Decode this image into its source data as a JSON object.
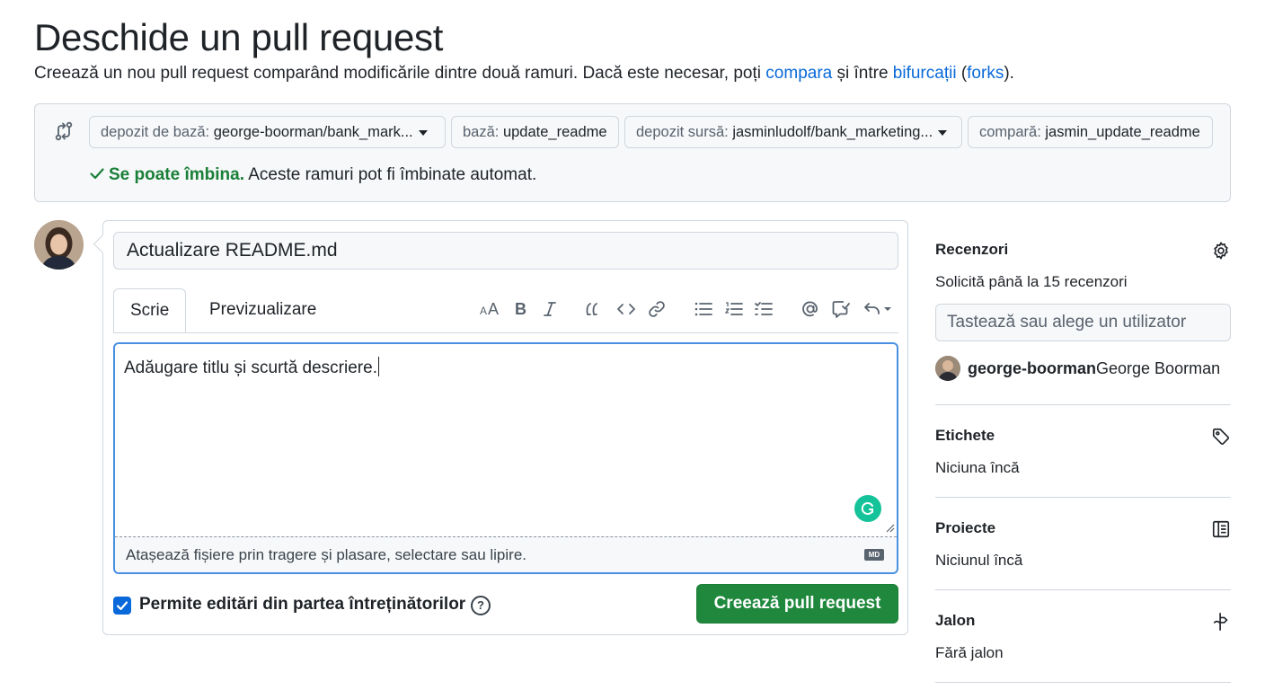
{
  "page": {
    "title": "Deschide un pull request",
    "subtitle_prefix": "Creează un nou pull request comparând modificările dintre două ramuri. Dacă este necesar, poți ",
    "link_compare": "compara",
    "subtitle_mid": " și între ",
    "link_forks_ro": "bifurcații",
    "paren_open": " (",
    "link_forks": "forks",
    "paren_close": ")."
  },
  "compare": {
    "base_repo_label": "depozit de bază: ",
    "base_repo_value": "george-boorman/bank_mark...",
    "base_label": "bază: ",
    "base_value": "update_readme",
    "head_repo_label": "depozit sursă: ",
    "head_repo_value": "jasminludolf/bank_marketing...",
    "compare_label": "compară: ",
    "compare_value": "jasmin_update_readme",
    "merge_ok": "Se poate îmbina.",
    "merge_text": " Aceste ramuri pot fi îmbinate automat."
  },
  "form": {
    "title_value": "Actualizare README.md",
    "tab_write": "Scrie",
    "tab_preview": "Previzualizare",
    "body_value": "Adăugare titlu și scurtă descriere.",
    "attach_text": "Atașează fișiere prin tragere și plasare, selectare sau lipire.",
    "markdown_badge": "MD",
    "allow_edits_label": "Permite editări din partea întreținătorilor",
    "help_glyph": "?",
    "create_button": "Creează pull request",
    "toolbar_icons": [
      "heading-icon",
      "bold-icon",
      "italic-icon",
      "quote-icon",
      "code-icon",
      "link-icon",
      "unordered-list-icon",
      "ordered-list-icon",
      "task-list-icon",
      "mention-icon",
      "reference-icon",
      "undo-icon"
    ]
  },
  "sidebar": {
    "reviewers_title": "Recenzori",
    "reviewers_hint": "Solicită până la 15 recenzori",
    "reviewers_placeholder": "Tastează sau alege un utilizator",
    "reviewer_login": "george-boorman",
    "reviewer_name": " George Boorman",
    "labels_title": "Etichete",
    "labels_value": "Niciuna încă",
    "projects_title": "Proiecte",
    "projects_value": "Niciunul încă",
    "milestone_title": "Jalon",
    "milestone_value": "Fără jalon"
  },
  "colors": {
    "accent": "#0969da",
    "success": "#1f883d",
    "border": "#d0d7de",
    "muted": "#59636e"
  }
}
